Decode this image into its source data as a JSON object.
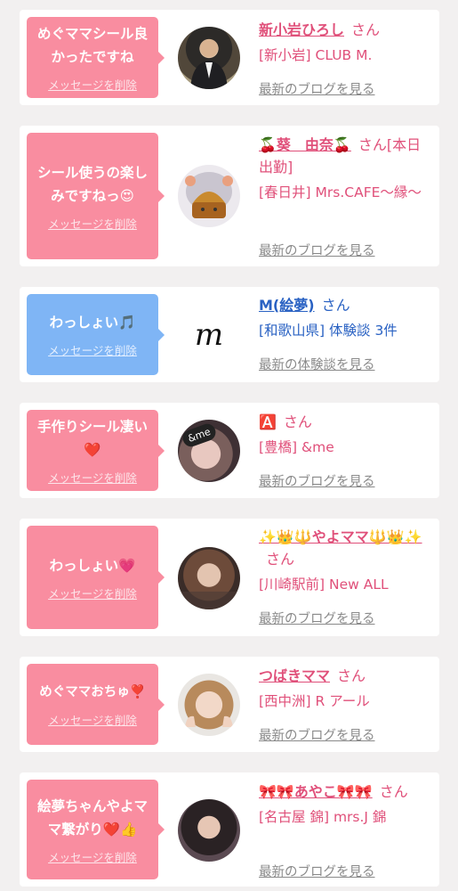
{
  "delete_label": "メッセージを削除",
  "colors": {
    "pink": "#f98da0",
    "blue": "#7fb5f5",
    "name_pink": "#e0507a",
    "name_blue": "#2a62c3"
  },
  "cards": [
    {
      "message": "めぐママシール良かったですね",
      "name": "新小岩ひろし",
      "san": "さん",
      "shop": "[新小岩] CLUB M.",
      "link": "最新のブログを見る"
    },
    {
      "message": "シール使うの楽しみですねっ😍",
      "name": "🍒葵　由奈🍒",
      "san": "さん[本日出勤]",
      "shop": "[春日井] Mrs.CAFE〜縁〜",
      "link": "最新のブログを見る"
    },
    {
      "message": "わっしょい🎵",
      "name": "M(絵夢)",
      "san": "さん",
      "shop": "[和歌山県] 体験談 3件",
      "link": "最新の体験談を見る",
      "avatar_text": "m"
    },
    {
      "message": "手作りシール凄い❤️",
      "name": "🅰️",
      "san": "さん",
      "shop": "[豊橋] &me",
      "link": "最新のブログを見る",
      "avatar_text": "&me"
    },
    {
      "message": "わっしょい💗",
      "name": "✨👑🔱やよママ🔱👑✨",
      "san": "さん",
      "shop": "[川崎駅前] New ALL",
      "link": "最新のブログを見る"
    },
    {
      "message": "めぐママおちゅ❣️",
      "name": "つばきママ",
      "san": "さん",
      "shop": "[西中洲] R アール",
      "link": "最新のブログを見る"
    },
    {
      "message": "絵夢ちゃんやよママ繋がり❤️👍",
      "name": "🎀🎀あやこ🎀🎀",
      "san": "さん",
      "shop": "[名古屋 錦] mrs.J 錦",
      "link": "最新のブログを見る"
    }
  ]
}
